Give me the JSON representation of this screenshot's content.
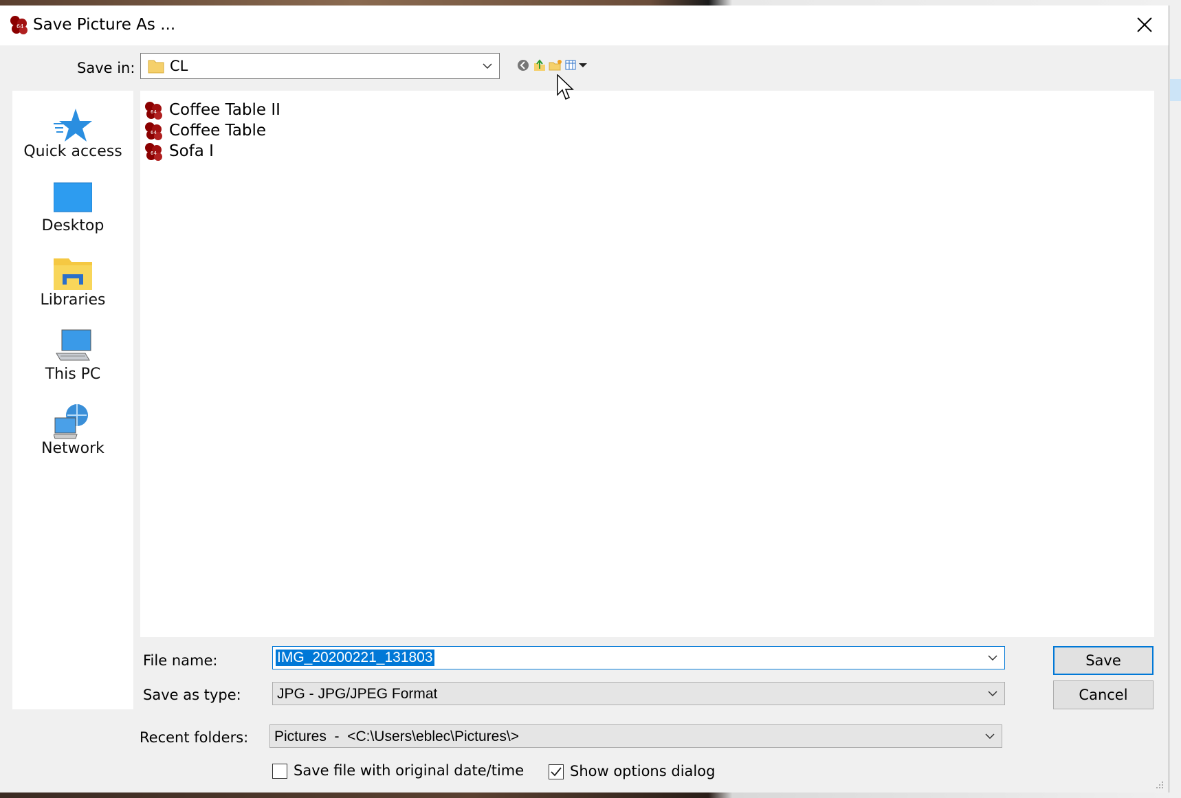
{
  "window": {
    "title": "Save Picture As ..."
  },
  "toolbar": {
    "save_in_label": "Save in:",
    "save_in_value": "CL",
    "icons": [
      "back-icon",
      "up-folder-icon",
      "new-folder-icon",
      "view-menu-icon"
    ]
  },
  "places": [
    {
      "label": "Quick access",
      "icon": "star-icon"
    },
    {
      "label": "Desktop",
      "icon": "desktop-icon"
    },
    {
      "label": "Libraries",
      "icon": "libraries-icon"
    },
    {
      "label": "This PC",
      "icon": "computer-icon"
    },
    {
      "label": "Network",
      "icon": "network-icon"
    }
  ],
  "files": [
    {
      "name": "Coffee Table II"
    },
    {
      "name": "Coffee Table"
    },
    {
      "name": "Sofa I"
    }
  ],
  "form": {
    "file_name_label": "File name:",
    "file_name_value": "IMG_20200221_131803",
    "save_type_label": "Save as type:",
    "save_type_value": "JPG - JPG/JPEG Format",
    "recent_label": "Recent folders:",
    "recent_value": "Pictures  -  <C:\\Users\\eblec\\Pictures\\>",
    "save_original_date_label": "Save file with original date/time",
    "save_original_date_checked": false,
    "show_options_label": "Show options dialog",
    "show_options_checked": true
  },
  "buttons": {
    "save": "Save",
    "cancel": "Cancel"
  },
  "colors": {
    "accent": "#0078d7",
    "dialog_bg": "#f0f0f0",
    "app_icon": "#8b0000"
  }
}
